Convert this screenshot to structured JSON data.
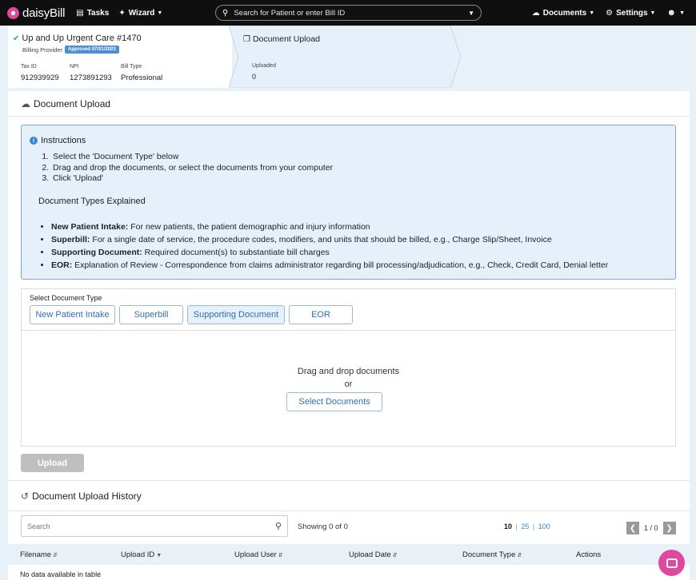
{
  "app": {
    "brand": "daisyBill",
    "accent": "#e0479e"
  },
  "nav": {
    "tasks": "Tasks",
    "wizard": "Wizard",
    "search_placeholder": "Search for Patient or enter Bill ID",
    "documents": "Documents",
    "settings": "Settings"
  },
  "provider": {
    "name": "Up and Up Urgent Care #1470",
    "role": "Billing Provider",
    "badge": "Approved 07/31/2023",
    "tax_id_label": "Tax ID",
    "tax_id": "912939929",
    "npi_label": "NPI",
    "npi": "1273891293",
    "bill_type_label": "Bill Type",
    "bill_type": "Professional"
  },
  "step": {
    "title": "Document Upload",
    "uploaded_label": "Uploaded",
    "uploaded_value": "0"
  },
  "upload_section": {
    "title": "Document Upload",
    "instructions_title": "Instructions",
    "steps": [
      "Select the 'Document Type' below",
      "Drag and drop the documents, or select the documents from your computer",
      "Click 'Upload'"
    ],
    "types_title": "Document Types Explained",
    "types": [
      {
        "name": "New Patient Intake:",
        "desc": " For new patients, the patient demographic and injury information"
      },
      {
        "name": "Superbill:",
        "desc": " For a single date of service, the procedure codes, modifiers, and units that should be billed, e.g., Charge Slip/Sheet, Invoice"
      },
      {
        "name": "Supporting Document:",
        "desc": " Required document(s) to substantiate bill charges"
      },
      {
        "name": "EOR:",
        "desc": " Explanation of Review - Correspondence from claims administrator regarding bill processing/adjudication, e.g., Check, Credit Card, Denial letter"
      }
    ],
    "select_type_label": "Select Document Type",
    "type_buttons": [
      "New Patient Intake",
      "Superbill",
      "Supporting Document",
      "EOR"
    ],
    "selected_type": "Supporting Document",
    "drag_text": "Drag and drop documents",
    "or_text": "or",
    "select_button": "Select Documents",
    "upload_button": "Upload"
  },
  "history": {
    "title": "Document Upload History",
    "search_placeholder": "Search",
    "showing": "Showing 0 of 0",
    "page_sizes": [
      "10",
      "25",
      "100"
    ],
    "current_page_size": "10",
    "page_info": "1 / 0",
    "columns": [
      "Filename",
      "Upload ID",
      "Upload User",
      "Upload Date",
      "Document Type",
      "Actions"
    ],
    "empty_text": "No data available in table"
  }
}
